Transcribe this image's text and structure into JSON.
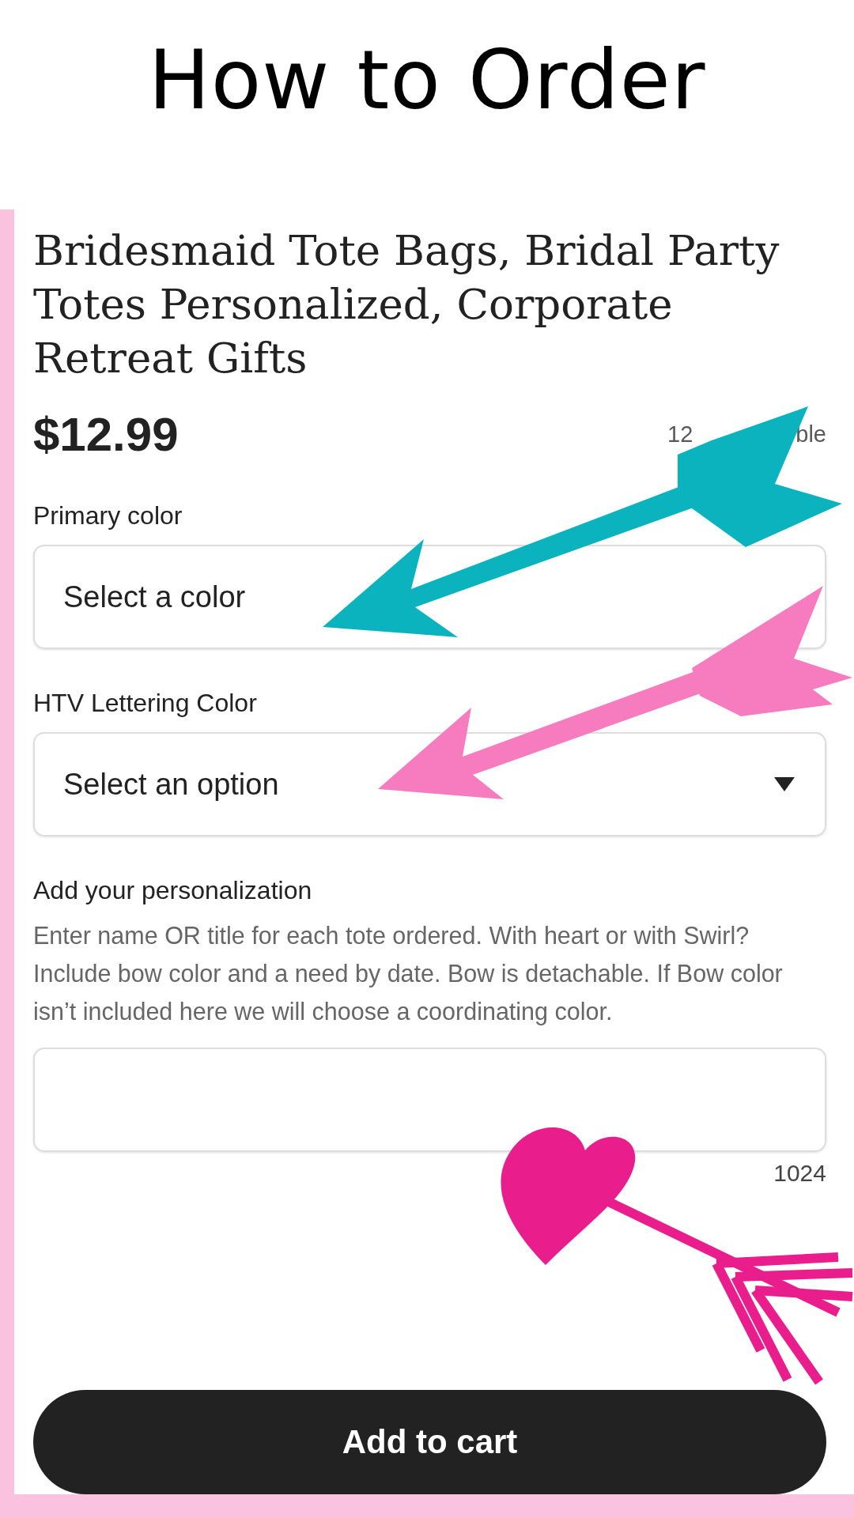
{
  "header": {
    "title": "How to Order"
  },
  "listing": {
    "title": "Bridesmaid Tote Bags, Bridal Party Totes Personalized, Corporate Retreat Gifts",
    "price": "$12.99",
    "stock_start": "12",
    "stock_end": "ble",
    "fields": [
      {
        "kind": "plain",
        "label": "Primary color",
        "value": "Select a color"
      },
      {
        "kind": "dropdown",
        "label": "HTV Lettering Color",
        "value": "Select an option"
      }
    ],
    "personalization": {
      "label": "Add your personalization",
      "instructions": "Enter name OR title for each tote ordered. With heart or with Swirl? Include bow color and a need by date. Bow is detachable. If Bow color isn’t included here we will choose a coordinating color.",
      "counter": "1024"
    },
    "button": "Add to cart"
  }
}
